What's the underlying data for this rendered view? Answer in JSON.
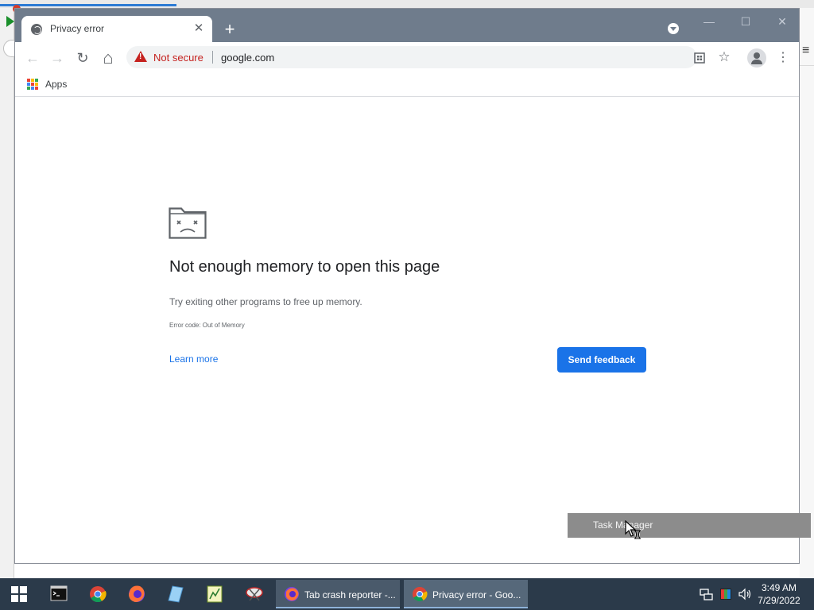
{
  "browser": {
    "tab": {
      "title": "Privacy error",
      "close_glyph": "✕"
    },
    "newtab_glyph": "+",
    "window_controls": {
      "minimize": "—",
      "maximize": "☐",
      "close": "✕"
    },
    "toolbar": {
      "back": "←",
      "forward": "→",
      "reload": "↻",
      "home": "⌂",
      "security_text": "Not secure",
      "url": "google.com",
      "translate_icon": "translate-icon",
      "bookmark_star": "☆",
      "menu_glyph": "⋮"
    },
    "bookmarks": {
      "apps_label": "Apps"
    }
  },
  "page": {
    "heading": "Not enough memory to open this page",
    "description": "Try exiting other programs to free up memory.",
    "error_code": "Error code: Out of Memory",
    "learn_more": "Learn more",
    "send_feedback": "Send feedback"
  },
  "overlay": {
    "task_manager": "Task Manager"
  },
  "taskbar": {
    "buttons": [
      {
        "label": "Tab crash reporter -..."
      },
      {
        "label": "Privacy error - Goo..."
      }
    ],
    "clock": {
      "time": "3:49 AM",
      "date": "7/29/2022"
    }
  },
  "colors": {
    "titlebar": "#6f7c8c",
    "accent": "#1a73e8",
    "danger": "#c5221f",
    "taskbar": "#2b3a4a"
  }
}
